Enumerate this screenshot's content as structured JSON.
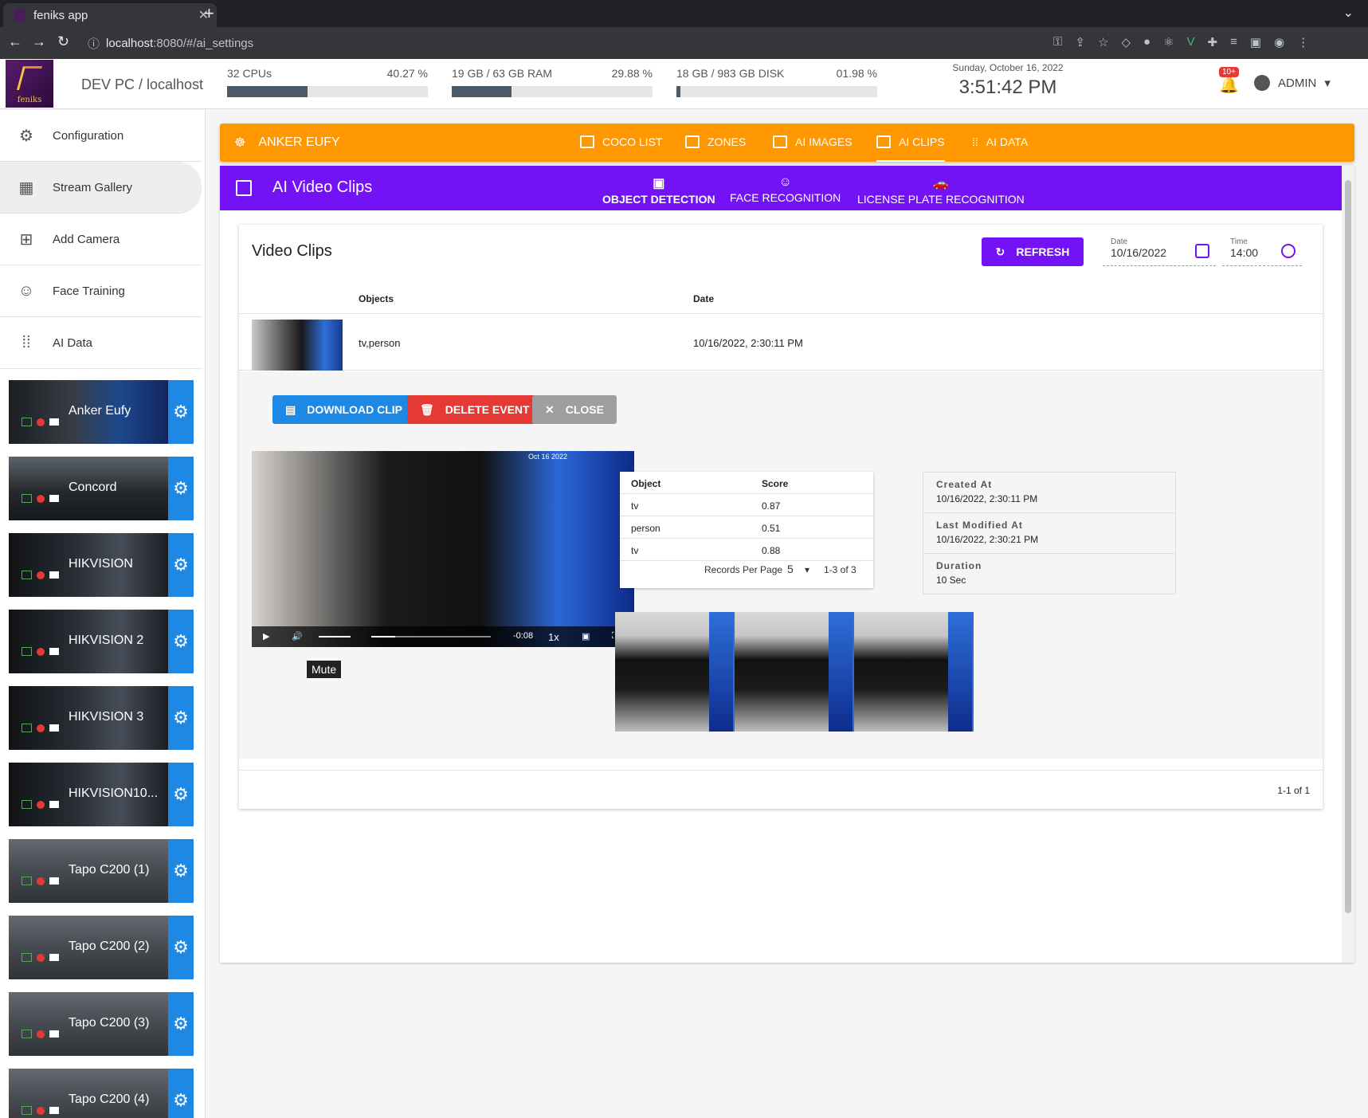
{
  "browser": {
    "tab_title": "feniks app",
    "url_host": "localhost",
    "url_rest": ":8080/#/ai_settings"
  },
  "header": {
    "host": "DEV PC / localhost",
    "cpu": {
      "label": "32 CPUs",
      "percent": "40.27 %",
      "fill": 40.27
    },
    "ram": {
      "label": "19 GB / 63 GB RAM",
      "percent": "29.88 %",
      "fill": 29.88
    },
    "disk": {
      "label": "18 GB / 983 GB DISK",
      "percent": "01.98 %",
      "fill": 1.98
    },
    "date": "Sunday, October 16, 2022",
    "time": "3:51:42 PM",
    "notifications": "10+",
    "user": "ADMIN",
    "logo_text": "feniks"
  },
  "sidebar": {
    "items": [
      {
        "label": "Configuration",
        "icon": "gear-icon"
      },
      {
        "label": "Stream Gallery",
        "icon": "grid-icon"
      },
      {
        "label": "Add Camera",
        "icon": "plus-box-icon"
      },
      {
        "label": "Face Training",
        "icon": "face-icon"
      },
      {
        "label": "AI Data",
        "icon": "dots-grid-icon"
      }
    ],
    "cameras": [
      {
        "name": "Anker Eufy"
      },
      {
        "name": "Concord"
      },
      {
        "name": "HIKVISION"
      },
      {
        "name": "HIKVISION 2"
      },
      {
        "name": "HIKVISION 3"
      },
      {
        "name": "HIKVISION10..."
      },
      {
        "name": "Tapo C200 (1)"
      },
      {
        "name": "Tapo C200 (2)"
      },
      {
        "name": "Tapo C200 (3)"
      },
      {
        "name": "Tapo C200 (4)"
      }
    ]
  },
  "camera_tabs": {
    "camera": "ANKER EUFY",
    "tabs": [
      "COCO LIST",
      "ZONES",
      "AI IMAGES",
      "AI CLIPS",
      "AI DATA"
    ],
    "active": "AI CLIPS"
  },
  "panel": {
    "title": "AI Video Clips",
    "subtabs": [
      "OBJECT DETECTION",
      "FACE RECOGNITION",
      "LICENSE PLATE RECOGNITION"
    ]
  },
  "clips": {
    "title": "Video Clips",
    "refresh_label": "REFRESH",
    "date_label": "Date",
    "date_value": "10/16/2022",
    "time_label": "Time",
    "time_value": "14:00",
    "columns": [
      "Objects",
      "Date"
    ],
    "rows": [
      {
        "objects": "tv,person",
        "date": "10/16/2022, 2:30:11 PM"
      }
    ],
    "pagination": "1-1 of 1"
  },
  "detail": {
    "download_label": "DOWNLOAD CLIP",
    "delete_label": "DELETE EVENT",
    "close_label": "CLOSE",
    "video": {
      "remaining": "-0:08",
      "speed": "1x",
      "tooltip": "Mute",
      "stamp": "Oct 16 2022"
    },
    "objects_table": {
      "columns": [
        "Object",
        "Score"
      ],
      "rows": [
        {
          "object": "tv",
          "score": "0.87"
        },
        {
          "object": "person",
          "score": "0.51"
        },
        {
          "object": "tv",
          "score": "0.88"
        }
      ],
      "records_label": "Records Per Page",
      "records_value": "5",
      "range": "1-3 of 3"
    },
    "info": {
      "created_label": "Created At",
      "created_value": "10/16/2022, 2:30:11 PM",
      "modified_label": "Last Modified At",
      "modified_value": "10/16/2022, 2:30:21 PM",
      "duration_label": "Duration",
      "duration_value": "10 Sec"
    }
  },
  "colors": {
    "orange": "#ff9800",
    "purple": "#7312f5",
    "blue": "#1e88e5",
    "red": "#e53935",
    "grey": "#9e9e9e"
  }
}
